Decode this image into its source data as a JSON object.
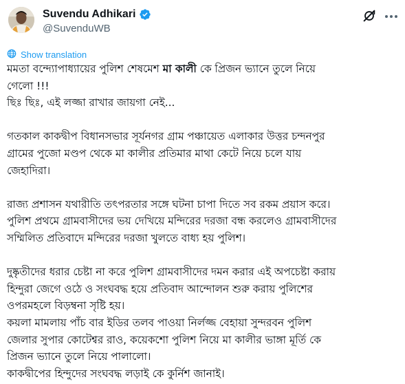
{
  "author": {
    "display_name": "Suvendu Adhikari",
    "handle": "@SuvenduWB",
    "verified_badge_color": "#1d9bf0",
    "avatar_icon": "profile-photo"
  },
  "actions": {
    "grok_icon": "grok-icon",
    "more_icon": "more-options-icon"
  },
  "translation": {
    "label": "Show translation",
    "icon": "globe-icon"
  },
  "post": {
    "p1": {
      "l1a": "মমতা বন্দ্যোপাধ্যায়ের পুলিশ শেষমেশ ",
      "l1b": "মা কালী",
      "l1c": " কে প্রিজন ভ্যানে তুলে নিয়ে",
      "l2": "গেলো !!!",
      "l3": "ছিঃ ছিঃ, এই লজ্জা রাখার জায়গা নেই..."
    },
    "p2": [
      "গতকাল কাকদ্বীপ বিধানসভার সূর্যনগর গ্রাম পঞ্চায়েত এলাকার উত্তর চন্দনপুর",
      "গ্রামের পুজো মণ্ডপ থেকে মা কালীর প্রতিমার মাথা কেটে নিয়ে চলে যায়",
      "জেহাদিরা।"
    ],
    "p3": [
      "রাজ্য প্রশাসন যথারীতি তৎপরতার সঙ্গে ঘটনা চাপা দিতে সব রকম প্রয়াস করে।",
      "পুলিশ প্রথমে গ্রামবাসীদের ভয় দেখিয়ে মন্দিরের দরজা বন্ধ করলেও গ্রামবাসীদের",
      "সম্মিলিত প্রতিবাদে মন্দিরের দরজা খুলতে বাধ্য হয় পুলিশ।"
    ],
    "p4": [
      "দুষ্কৃতীদের ধরার চেষ্টা না করে পুলিশ গ্রামবাসীদের দমন করার এই অপচেষ্টা করায়",
      "হিন্দুরা জেগে ওঠে ও সংঘবদ্ধ হয়ে প্রতিবাদ আন্দোলন শুরু করায় পুলিশের",
      "ওপরমহলে বিড়ম্বনা সৃষ্টি হয়।",
      "কয়লা মামলায় পাঁচ বার ইডির তলব পাওয়া নির্লজ্জ বেহায়া সুন্দরবন পুলিশ",
      "জেলার সুপার কোটেশ্বর রাও, কয়েকশো পুলিশ নিয়ে মা কালীর ভাঙ্গা মূর্তি কে",
      "প্রিজন ভ্যানে তুলে নিয়ে পালালো।",
      "কাকদ্বীপের হিন্দুদের সংঘবদ্ধ লড়াই কে কুর্নিশ জানাই।"
    ]
  }
}
